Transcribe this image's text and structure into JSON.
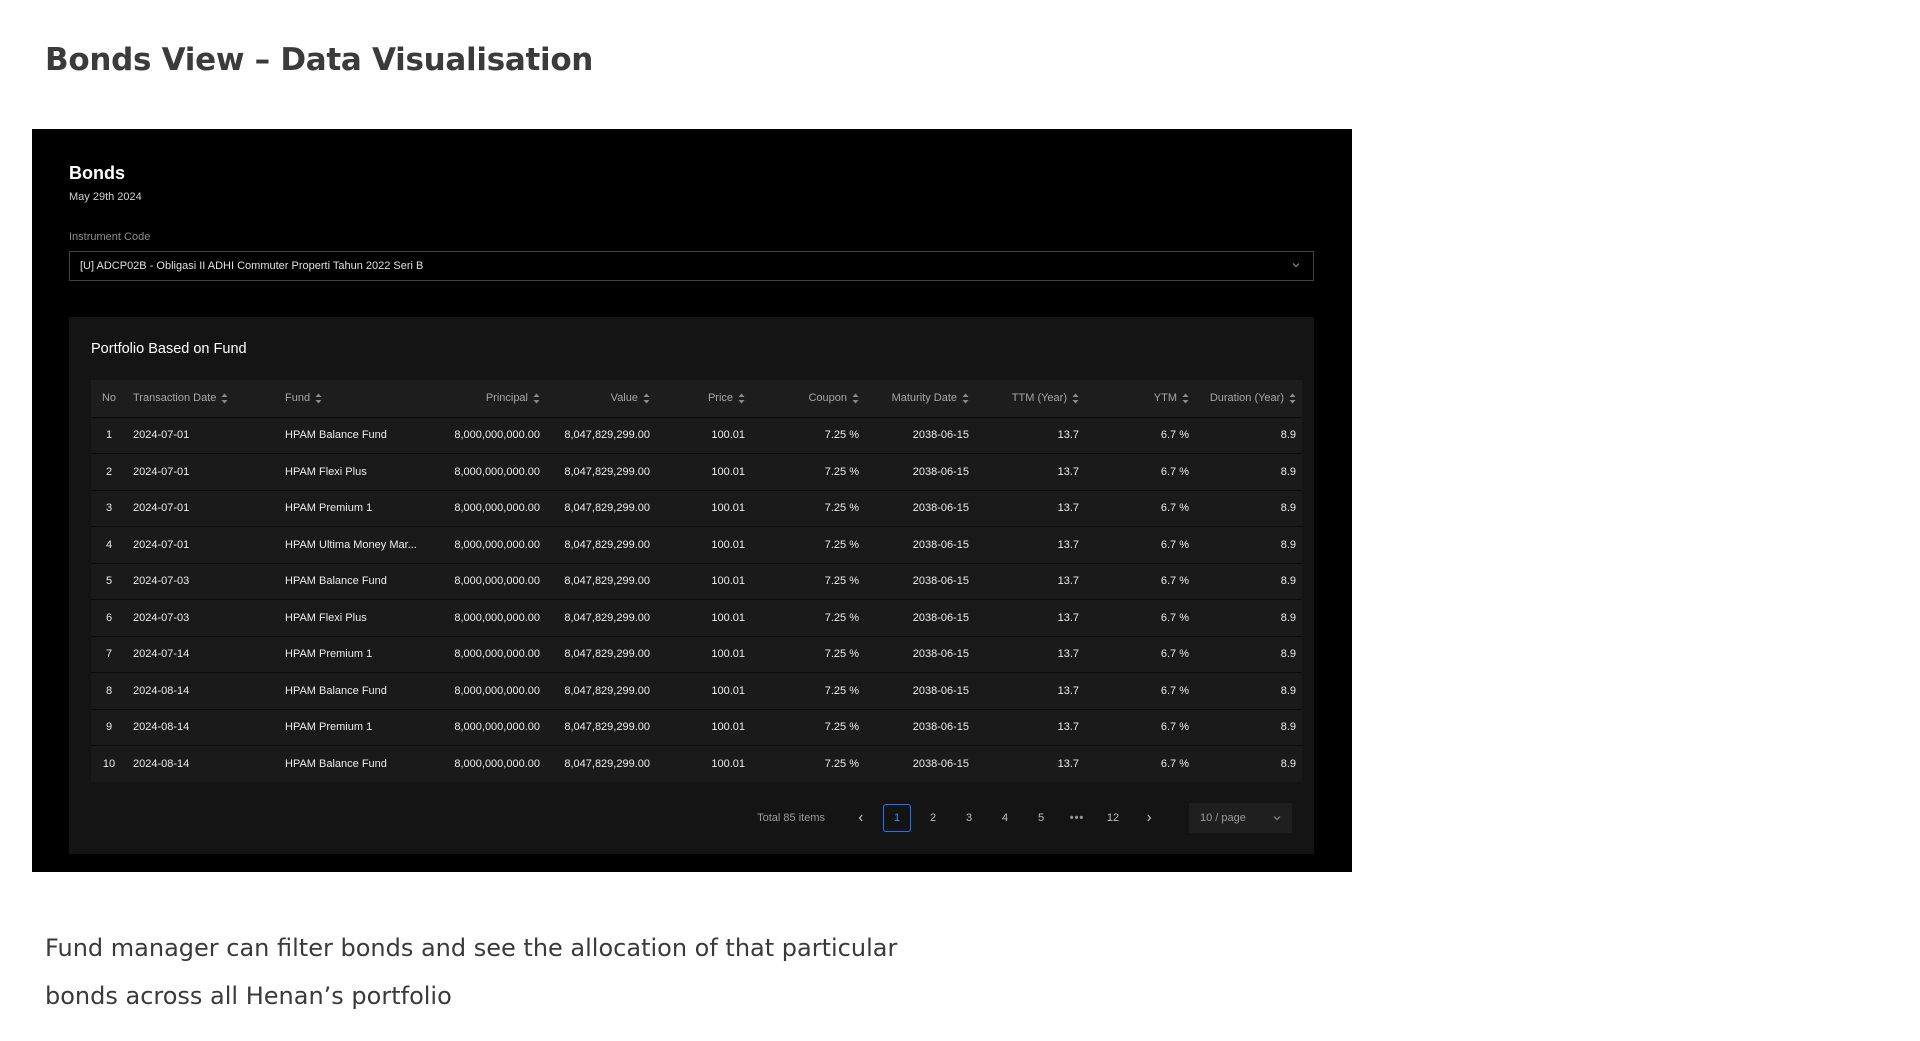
{
  "page": {
    "title": "Bonds View – Data Visualisation",
    "caption_line1": "Fund manager can filter bonds and see the allocation of that particular",
    "caption_line2": "bonds across all Henan’s portfolio"
  },
  "app": {
    "title": "Bonds",
    "date": "May 29th 2024",
    "instrument_label": "Instrument Code",
    "instrument_value": "[U] ADCP02B - Obligasi II ADHI Commuter Properti Tahun 2022 Seri B"
  },
  "portfolio": {
    "title": "Portfolio Based on Fund",
    "columns": {
      "no": "No",
      "transaction_date": "Transaction Date",
      "fund": "Fund",
      "principal": "Principal",
      "value": "Value",
      "price": "Price",
      "coupon": "Coupon",
      "maturity_date": "Maturity Date",
      "ttm": "TTM (Year)",
      "ytm": "YTM",
      "duration": "Duration (Year)"
    },
    "rows": [
      {
        "no": "1",
        "date": "2024-07-01",
        "fund": "HPAM Balance Fund",
        "principal": "8,000,000,000.00",
        "value": "8,047,829,299.00",
        "price": "100.01",
        "coupon": "7.25 %",
        "maturity": "2038-06-15",
        "ttm": "13.7",
        "ytm": "6.7 %",
        "duration": "8.9"
      },
      {
        "no": "2",
        "date": "2024-07-01",
        "fund": "HPAM Flexi Plus",
        "principal": "8,000,000,000.00",
        "value": "8,047,829,299.00",
        "price": "100.01",
        "coupon": "7.25 %",
        "maturity": "2038-06-15",
        "ttm": "13.7",
        "ytm": "6.7 %",
        "duration": "8.9"
      },
      {
        "no": "3",
        "date": "2024-07-01",
        "fund": "HPAM Premium 1",
        "principal": "8,000,000,000.00",
        "value": "8,047,829,299.00",
        "price": "100.01",
        "coupon": "7.25 %",
        "maturity": "2038-06-15",
        "ttm": "13.7",
        "ytm": "6.7 %",
        "duration": "8.9"
      },
      {
        "no": "4",
        "date": "2024-07-01",
        "fund": "HPAM Ultima Money Mar...",
        "principal": "8,000,000,000.00",
        "value": "8,047,829,299.00",
        "price": "100.01",
        "coupon": "7.25 %",
        "maturity": "2038-06-15",
        "ttm": "13.7",
        "ytm": "6.7 %",
        "duration": "8.9"
      },
      {
        "no": "5",
        "date": "2024-07-03",
        "fund": "HPAM Balance Fund",
        "principal": "8,000,000,000.00",
        "value": "8,047,829,299.00",
        "price": "100.01",
        "coupon": "7.25 %",
        "maturity": "2038-06-15",
        "ttm": "13.7",
        "ytm": "6.7 %",
        "duration": "8.9"
      },
      {
        "no": "6",
        "date": "2024-07-03",
        "fund": "HPAM Flexi Plus",
        "principal": "8,000,000,000.00",
        "value": "8,047,829,299.00",
        "price": "100.01",
        "coupon": "7.25 %",
        "maturity": "2038-06-15",
        "ttm": "13.7",
        "ytm": "6.7 %",
        "duration": "8.9"
      },
      {
        "no": "7",
        "date": "2024-07-14",
        "fund": "HPAM Premium 1",
        "principal": "8,000,000,000.00",
        "value": "8,047,829,299.00",
        "price": "100.01",
        "coupon": "7.25 %",
        "maturity": "2038-06-15",
        "ttm": "13.7",
        "ytm": "6.7 %",
        "duration": "8.9"
      },
      {
        "no": "8",
        "date": "2024-08-14",
        "fund": "HPAM Balance Fund",
        "principal": "8,000,000,000.00",
        "value": "8,047,829,299.00",
        "price": "100.01",
        "coupon": "7.25 %",
        "maturity": "2038-06-15",
        "ttm": "13.7",
        "ytm": "6.7 %",
        "duration": "8.9"
      },
      {
        "no": "9",
        "date": "2024-08-14",
        "fund": "HPAM Premium 1",
        "principal": "8,000,000,000.00",
        "value": "8,047,829,299.00",
        "price": "100.01",
        "coupon": "7.25 %",
        "maturity": "2038-06-15",
        "ttm": "13.7",
        "ytm": "6.7 %",
        "duration": "8.9"
      },
      {
        "no": "10",
        "date": "2024-08-14",
        "fund": "HPAM Balance Fund",
        "principal": "8,000,000,000.00",
        "value": "8,047,829,299.00",
        "price": "100.01",
        "coupon": "7.25 %",
        "maturity": "2038-06-15",
        "ttm": "13.7",
        "ytm": "6.7 %",
        "duration": "8.9"
      }
    ]
  },
  "pagination": {
    "total": "Total 85 items",
    "pages": [
      "1",
      "2",
      "3",
      "4",
      "5"
    ],
    "ellipsis": "•••",
    "last_page": "12",
    "current": "1",
    "page_size": "10 / page"
  },
  "colors": {
    "accent": "#1677ff",
    "panel_bg": "#141414",
    "screen_bg": "#000000"
  },
  "icons": {
    "select_chevron": "chevron-down-icon",
    "sort": "sort-icon",
    "prev": "chevron-left-icon",
    "next": "chevron-right-icon"
  }
}
